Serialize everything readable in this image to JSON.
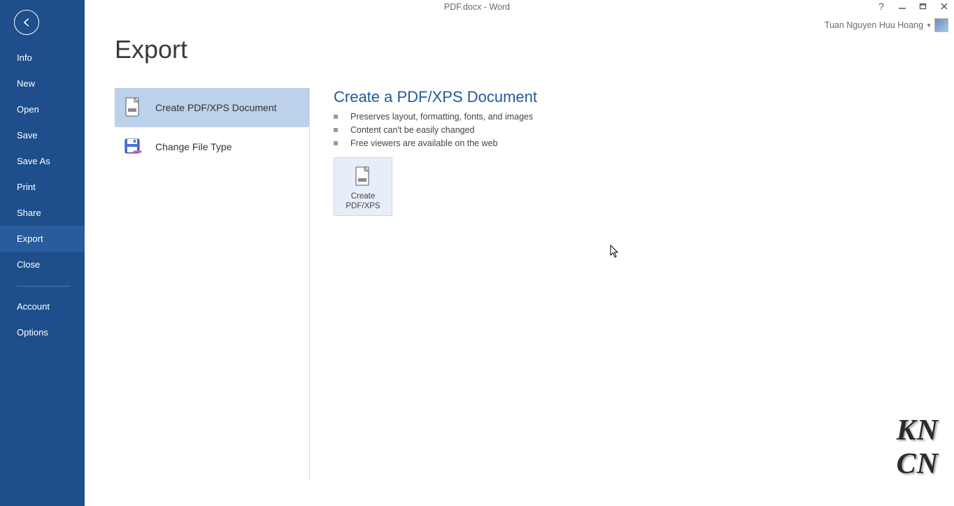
{
  "window_title": "PDF.docx - Word",
  "user": {
    "name": "Tuan Nguyen Huu Hoang"
  },
  "sidebar": {
    "items": [
      {
        "id": "info",
        "label": "Info"
      },
      {
        "id": "new",
        "label": "New"
      },
      {
        "id": "open",
        "label": "Open"
      },
      {
        "id": "save",
        "label": "Save"
      },
      {
        "id": "saveas",
        "label": "Save As"
      },
      {
        "id": "print",
        "label": "Print"
      },
      {
        "id": "share",
        "label": "Share"
      },
      {
        "id": "export",
        "label": "Export",
        "active": true
      },
      {
        "id": "close",
        "label": "Close"
      }
    ],
    "footer_items": [
      {
        "id": "account",
        "label": "Account"
      },
      {
        "id": "options",
        "label": "Options"
      }
    ]
  },
  "page": {
    "title": "Export",
    "options": [
      {
        "id": "pdfxps",
        "label": "Create PDF/XPS Document",
        "selected": true,
        "icon": "pdf-page-icon"
      },
      {
        "id": "changetype",
        "label": "Change File Type",
        "selected": false,
        "icon": "save-as-type-icon"
      }
    ],
    "detail": {
      "heading": "Create a PDF/XPS Document",
      "bullets": [
        "Preserves layout, formatting, fonts, and images",
        "Content can't be easily changed",
        "Free viewers are available on the web"
      ],
      "button_label": "Create\nPDF/XPS"
    }
  },
  "watermark": [
    "KN",
    "CN"
  ]
}
